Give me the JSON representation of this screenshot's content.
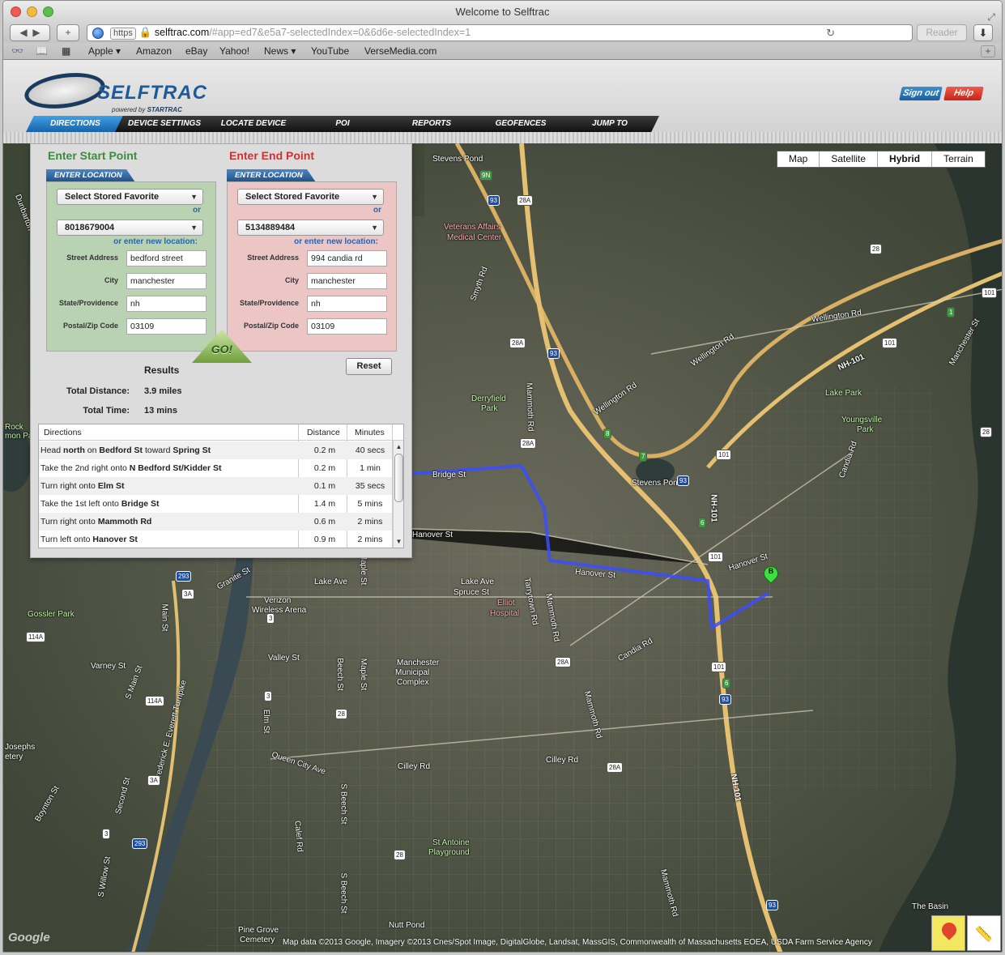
{
  "browser": {
    "title": "Welcome to Selftrac",
    "url_scheme": "https",
    "url_host": "selftrac.com",
    "url_path": "/#app=ed7&e5a7-selectedIndex=0&6d6e-selectedIndex=1",
    "reader_label": "Reader",
    "bookmarks": [
      "Apple ▾",
      "Amazon",
      "eBay",
      "Yahoo!",
      "News ▾",
      "YouTube",
      "VerseMedia.com"
    ]
  },
  "app": {
    "logo_text": "SELFTRAC",
    "logo_sub_prefix": "powered by",
    "logo_sub_brand": "STARTRAC",
    "sign_out": "Sign out",
    "help": "Help",
    "tabs": [
      "DIRECTIONS",
      "DEVICE SETTINGS",
      "LOCATE DEVICE",
      "POI",
      "REPORTS",
      "GEOFENCES",
      "JUMP TO"
    ],
    "active_tab": "DIRECTIONS"
  },
  "map": {
    "types": [
      "Map",
      "Satellite",
      "Hybrid",
      "Terrain"
    ],
    "selected_type": "Hybrid",
    "end_marker": "B",
    "copyright": "Map data ©2013  Google, Imagery ©2013  Cnes/Spot Image, DigitalGlobe, Landsat, MassGIS, Commonwealth of Massachusetts EOEA, USDA Farm Service Agency",
    "google_logo": "Google",
    "labels": {
      "stevens_pond_n": "Stevens Pond",
      "va_1": "Veterans Affairs",
      "va_2": "Medical Center",
      "smyth": "Smyth Rd",
      "wellington1": "Wellington Rd",
      "wellington2": "Wellington Rd",
      "wellington3": "Wellington Rd",
      "nh101": "NH-101",
      "manchester_st": "Manchester St",
      "derry_1": "Derryfield",
      "derry_2": "Park",
      "mammoth": "Mammoth Rd",
      "lake_park": "Lake Park",
      "youngs_1": "Youngsville",
      "youngs_2": "Park",
      "candia1": "Candia Rd",
      "bridge": "Bridge St",
      "stevens_pond_s": "Stevens Pond",
      "hanover1": "Hanover St",
      "hanover2": "Hanover St",
      "hanover3": "Hanover St",
      "nh101v": "NH-101",
      "lake_ave1": "Lake Ave",
      "lake_ave2": "Lake Ave",
      "spruce": "Spruce St",
      "elliot_1": "Elliot",
      "elliot_2": "Hospital",
      "tarrytown": "Tarrytown Rd",
      "mammoth2": "Mammoth Rd",
      "verizon_1": "Verizon",
      "verizon_2": "Wireless Arena",
      "granite": "Granite St",
      "gossler": "Gossler Park",
      "rock_1": "Rock",
      "rock_2": "mon Pa",
      "main": "Main St",
      "varney": "Varney St",
      "valley": "Valley St",
      "mmc_1": "Manchester",
      "mmc_2": "Municipal",
      "mmc_3": "Complex",
      "beech1": "Beech St",
      "maple1": "Maple St",
      "maple2": "Maple St",
      "candia2": "Candia Rd",
      "s_main": "S Main St",
      "turnpike": "Frederick E. Everett Turnpike",
      "elm": "Elm St",
      "queen": "Queen City Ave",
      "cilley1": "Cilley Rd",
      "cilley2": "Cilley Rd",
      "mammoth3": "Mammoth Rd",
      "mammoth4": "Mammoth Rd",
      "nh101c": "NH-101",
      "josephs_1": "Josephs",
      "josephs_2": "etery",
      "boynton": "Boynton St",
      "second": "Second St",
      "s_beech1": "S Beech St",
      "calef": "Calef Rd",
      "st_antoine_1": "St Antoine",
      "st_antoine_2": "Playground",
      "s_willow": "S Willow St",
      "s_beech2": "S Beech St",
      "pine_1": "Pine Grove",
      "pine_2": "Cemetery",
      "nutt": "Nutt Pond",
      "basin": "The Basin",
      "dunbarton": "Dunbarton"
    },
    "shields": {
      "s9n": "9N",
      "s93a": "93",
      "s28a1": "28A",
      "s28_1": "28",
      "s101_1": "101",
      "s101_2": "101",
      "s28a2": "28A",
      "s93b": "93",
      "s1": "1",
      "s8": "8",
      "s28a3": "28A",
      "s7": "7",
      "s101_3": "101",
      "s93c": "93",
      "s28_2": "28",
      "s6a": "6",
      "s101_4": "101",
      "s293a": "293",
      "s3a1": "3A",
      "s114a1": "114A",
      "s3_1": "3",
      "s114a2": "114A",
      "s3_2": "3",
      "s28_3": "28",
      "s28a4": "28A",
      "s101_5": "101",
      "s6b": "6",
      "s93d": "93",
      "s28a5": "28A",
      "s3a2": "3A",
      "s3_3": "3",
      "s293b": "293",
      "s28_4": "28",
      "s93e": "93"
    }
  },
  "directions": {
    "start": {
      "title": "Enter Start Point",
      "tab": "ENTER LOCATION",
      "favorite": "Select Stored Favorite",
      "or": "or",
      "device": "8018679004",
      "or_new": "or enter new location:",
      "street_label": "Street Address",
      "street": "bedford street",
      "city_label": "City",
      "city": "manchester",
      "state_label": "State/Providence",
      "state": "nh",
      "zip_label": "Postal/Zip Code",
      "zip": "03109"
    },
    "end": {
      "title": "Enter End Point",
      "tab": "ENTER LOCATION",
      "favorite": "Select Stored Favorite",
      "or": "or",
      "device": "5134889484",
      "or_new": "or enter new location:",
      "street_label": "Street Address",
      "street": "994 candia rd",
      "city_label": "City",
      "city": "manchester",
      "state_label": "State/Providence",
      "state": "nh",
      "zip_label": "Postal/Zip Code",
      "zip": "03109"
    },
    "go": "GO!",
    "reset": "Reset",
    "results_title": "Results",
    "total_distance_label": "Total Distance:",
    "total_distance": "3.9 miles",
    "total_time_label": "Total Time:",
    "total_time": "13 mins",
    "columns": [
      "Directions",
      "Distance",
      "Minutes"
    ],
    "steps": [
      {
        "pre": "Head ",
        "b1": "north",
        "mid": " on ",
        "b2": "Bedford St",
        "mid2": " toward ",
        "b3": "Spring St",
        "distance": "0.2 m",
        "time": "40 secs"
      },
      {
        "pre": "Take the 2nd right onto ",
        "b1": "N Bedford St/Kidder St",
        "mid": "",
        "b2": "",
        "mid2": "",
        "b3": "",
        "distance": "0.2 m",
        "time": "1 min"
      },
      {
        "pre": "Turn right onto ",
        "b1": "Elm St",
        "mid": "",
        "b2": "",
        "mid2": "",
        "b3": "",
        "distance": "0.1 m",
        "time": "35 secs"
      },
      {
        "pre": "Take the 1st left onto ",
        "b1": "Bridge St",
        "mid": "",
        "b2": "",
        "mid2": "",
        "b3": "",
        "distance": "1.4 m",
        "time": "5 mins"
      },
      {
        "pre": "Turn right onto ",
        "b1": "Mammoth Rd",
        "mid": "",
        "b2": "",
        "mid2": "",
        "b3": "",
        "distance": "0.6 m",
        "time": "2 mins"
      },
      {
        "pre": "Turn left onto ",
        "b1": "Hanover St",
        "mid": "",
        "b2": "",
        "mid2": "",
        "b3": "",
        "distance": "0.9 m",
        "time": "2 mins"
      }
    ]
  }
}
